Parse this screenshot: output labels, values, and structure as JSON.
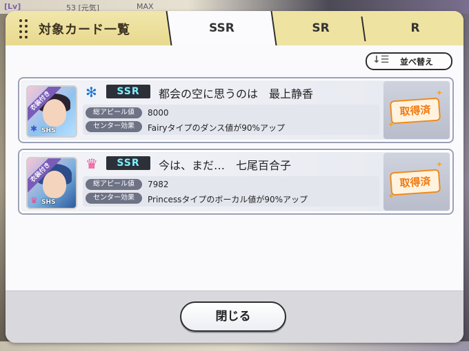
{
  "background": {
    "lv_label": "[Lv]",
    "lv_value": "53 [元気]",
    "max_label": "MAX"
  },
  "dialog": {
    "title": "対象カード一覧",
    "tabs": [
      {
        "label": "SSR",
        "selected": true
      },
      {
        "label": "SR",
        "selected": false
      },
      {
        "label": "R",
        "selected": false
      }
    ],
    "sort_label": "並べ替え",
    "sort_icon": "sort-icon",
    "close_label": "閉じる"
  },
  "cards": [
    {
      "type_icon": "fairy-icon",
      "type_color": "#1e73d8",
      "rarity": "SSR",
      "name": "都会の空に思うのは　最上静香",
      "appeal_label": "総アピール値",
      "appeal_value": "8000",
      "center_label": "センター効果",
      "center_value": "Fairyタイプのダンス値が90%アップ",
      "status": "取得済",
      "costume_label": "衣装付き",
      "thumb_rarity": "SHS"
    },
    {
      "type_icon": "princess-crown-icon",
      "type_color": "#e84d93",
      "rarity": "SSR",
      "name": "今は、まだ…　七尾百合子",
      "appeal_label": "総アピール値",
      "appeal_value": "7982",
      "center_label": "センター効果",
      "center_value": "Princessタイプのボーカル値が90%アップ",
      "status": "取得済",
      "costume_label": "衣装付き",
      "thumb_rarity": "SHS"
    }
  ]
}
